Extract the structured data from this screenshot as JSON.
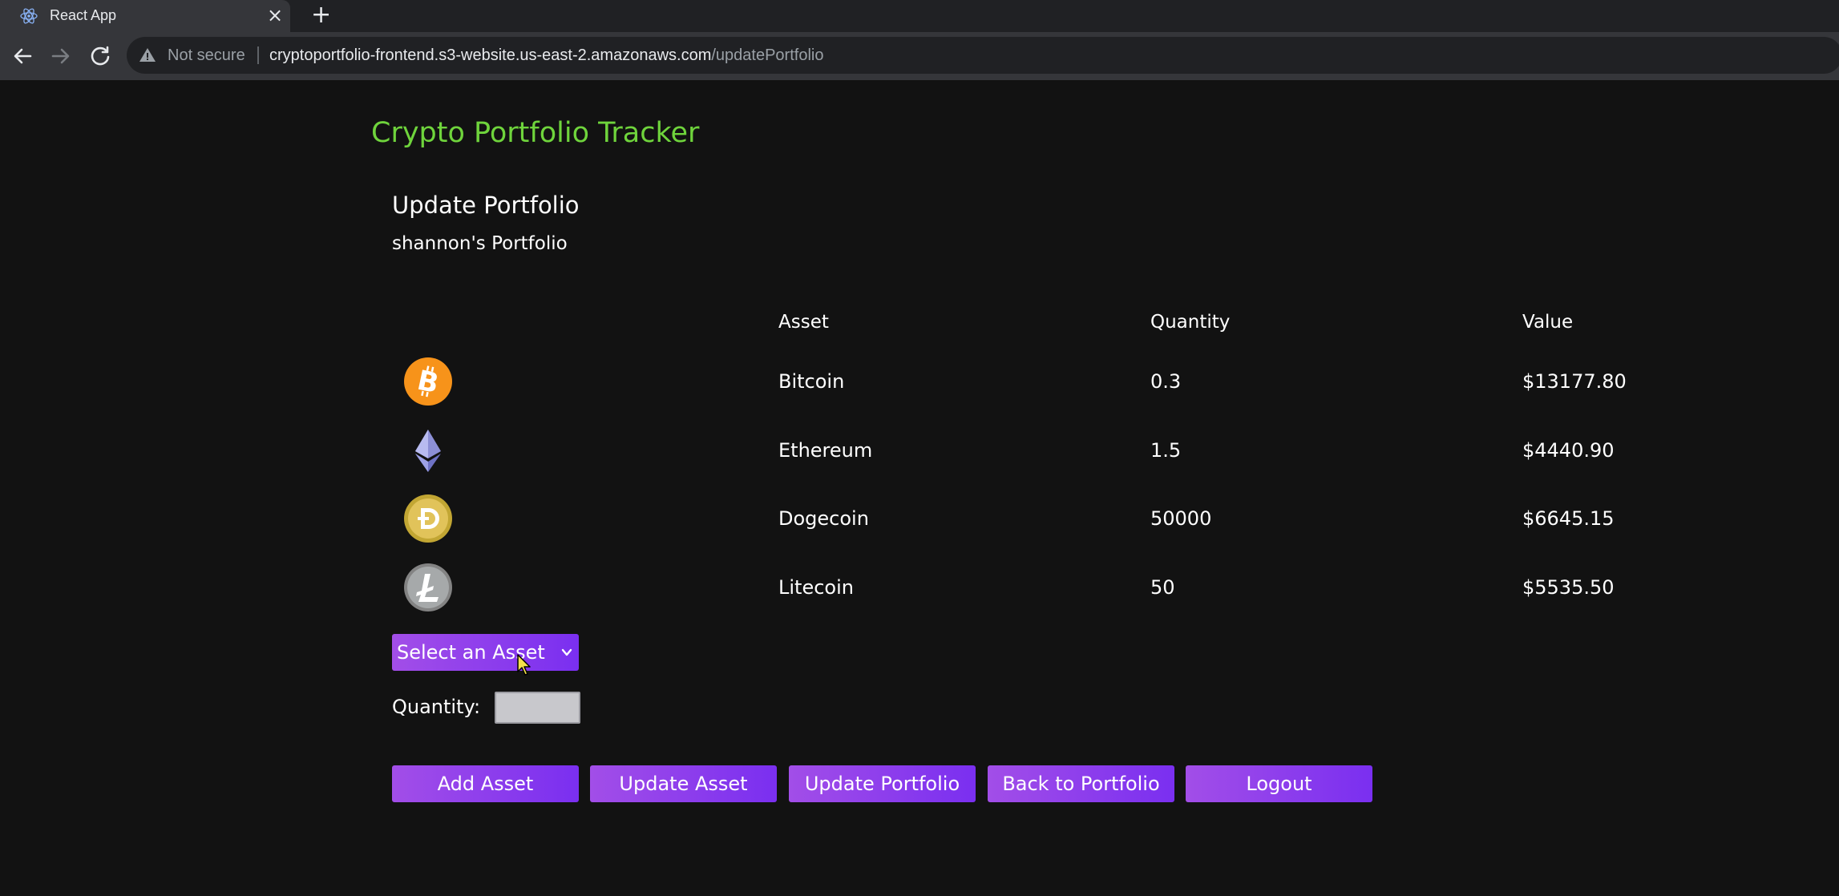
{
  "browser": {
    "tab_title": "React App",
    "tab_close": "×",
    "new_tab": "+",
    "security_label": "Not secure",
    "url_host": "cryptoportfolio-frontend.s3-website.us-east-2.amazonaws.com",
    "url_path": "/updatePortfolio"
  },
  "page": {
    "app_title": "Crypto Portfolio Tracker",
    "section_title": "Update Portfolio",
    "portfolio_owner": "shannon's Portfolio",
    "accent_color": "#6fd43c",
    "button_color": "#8a3ff0"
  },
  "table": {
    "headers": {
      "asset": "Asset",
      "quantity": "Quantity",
      "value": "Value"
    },
    "rows": [
      {
        "icon": "bitcoin-icon",
        "asset": "Bitcoin",
        "quantity": "0.3",
        "value": "$13177.80"
      },
      {
        "icon": "ethereum-icon",
        "asset": "Ethereum",
        "quantity": "1.5",
        "value": "$4440.90"
      },
      {
        "icon": "dogecoin-icon",
        "asset": "Dogecoin",
        "quantity": "50000",
        "value": "$6645.15"
      },
      {
        "icon": "litecoin-icon",
        "asset": "Litecoin",
        "quantity": "50",
        "value": "$5535.50"
      }
    ]
  },
  "form": {
    "asset_select_value": "Select an Asset",
    "quantity_label": "Quantity:",
    "quantity_value": ""
  },
  "buttons": {
    "add_asset": "Add Asset",
    "update_asset": "Update Asset",
    "update_portfolio": "Update Portfolio",
    "back_to_portfolio": "Back to Portfolio",
    "logout": "Logout"
  }
}
